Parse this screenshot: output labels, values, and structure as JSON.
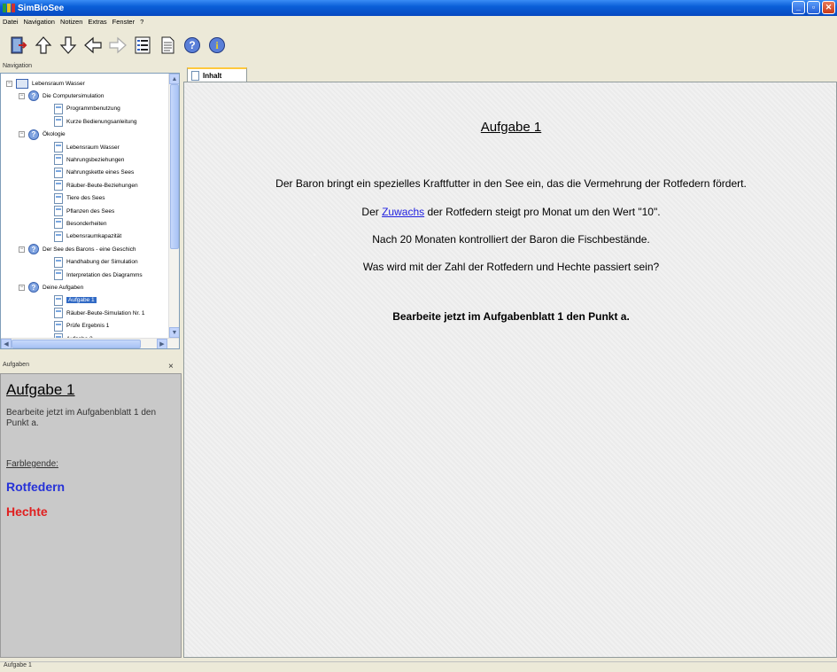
{
  "window": {
    "title": "SimBioSee"
  },
  "menu": [
    "Datei",
    "Navigation",
    "Notizen",
    "Extras",
    "Fenster",
    "?"
  ],
  "toolbar": {
    "icons": [
      "exit-icon",
      "arrow-up-icon",
      "arrow-down-icon",
      "arrow-left-icon",
      "arrow-right-icon",
      "outline-icon",
      "page-icon",
      "help-icon",
      "info-icon"
    ]
  },
  "navigation": {
    "header": "Navigation",
    "items": [
      {
        "label": "Lebensraum Wasser",
        "level": 0,
        "kind": "root"
      },
      {
        "label": "Die Computersimulation",
        "level": 1,
        "kind": "chapter"
      },
      {
        "label": "Programmbenutzung",
        "level": 2,
        "kind": "page"
      },
      {
        "label": "Kurze Bedienungsanleitung",
        "level": 2,
        "kind": "page"
      },
      {
        "label": "Ökologie",
        "level": 1,
        "kind": "chapter"
      },
      {
        "label": "Lebensraum Wasser",
        "level": 2,
        "kind": "page"
      },
      {
        "label": "Nahrungsbeziehungen",
        "level": 2,
        "kind": "page"
      },
      {
        "label": "Nahrungskette eines Sees",
        "level": 2,
        "kind": "page"
      },
      {
        "label": "Räuber-Beute-Beziehungen",
        "level": 2,
        "kind": "page"
      },
      {
        "label": "Tiere des Sees",
        "level": 2,
        "kind": "page"
      },
      {
        "label": "Pflanzen des Sees",
        "level": 2,
        "kind": "page"
      },
      {
        "label": "Besonderheiten",
        "level": 2,
        "kind": "page"
      },
      {
        "label": "Lebensraumkapazität",
        "level": 2,
        "kind": "page"
      },
      {
        "label": "Der See des Barons - eine Geschich",
        "level": 1,
        "kind": "chapter"
      },
      {
        "label": "Handhabung der Simulation",
        "level": 2,
        "kind": "page"
      },
      {
        "label": "Interpretation des Diagramms",
        "level": 2,
        "kind": "page"
      },
      {
        "label": "Deine Aufgaben",
        "level": 1,
        "kind": "chapter"
      },
      {
        "label": "Aufgabe 1",
        "level": 2,
        "kind": "page",
        "selected": true
      },
      {
        "label": "Räuber-Beute-Simulation Nr. 1",
        "level": 2,
        "kind": "page"
      },
      {
        "label": "Prüfe Ergebnis 1",
        "level": 2,
        "kind": "page"
      },
      {
        "label": "Aufgabe 2",
        "level": 2,
        "kind": "page"
      }
    ]
  },
  "tasks": {
    "header": "Aufgaben",
    "close": "×",
    "title": "Aufgabe 1",
    "text": "Bearbeite jetzt im Aufgabenblatt 1 den Punkt a.",
    "legend_label": "Farblegende:",
    "legend_rotfedern": "Rotfedern",
    "legend_hechte": "Hechte",
    "colors": {
      "rotfedern": "#2632d8",
      "hechte": "#e02020"
    }
  },
  "content": {
    "tab_label": "Inhalt",
    "title": "Aufgabe 1",
    "line1": "Der Baron bringt ein spezielles Kraftfutter in den See ein, das die Vermehrung der Rotfedern fördert.",
    "line2_before": "Der ",
    "line2_link": "Zuwachs",
    "line2_after": " der Rotfedern steigt pro Monat um den Wert \"10\".",
    "line3": "Nach 20 Monaten kontrolliert der Baron die Fischbestände.",
    "line4": "Was wird mit der Zahl der Rotfedern und Hechte passiert sein?",
    "instruction": "Bearbeite jetzt im Aufgabenblatt 1 den Punkt a."
  },
  "status": {
    "text": "Aufgabe 1"
  }
}
